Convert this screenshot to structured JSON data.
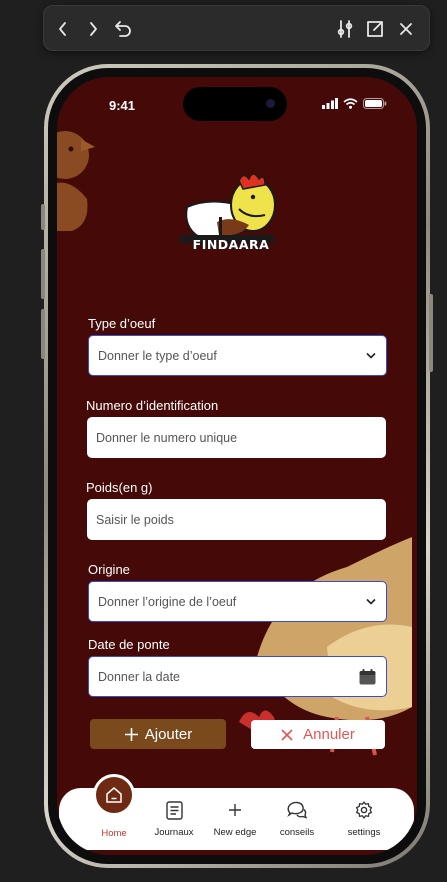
{
  "toolbar": {
    "icons": [
      "back-icon",
      "forward-icon",
      "refresh-icon",
      "sliders-icon",
      "open-external-icon",
      "close-icon"
    ]
  },
  "status": {
    "time": "9:41"
  },
  "logo": {
    "text": "FINDAARA"
  },
  "form": {
    "type_label": "Type d’oeuf",
    "type_placeholder": "Donner le type d’oeuf",
    "id_label": "Numero d’identification",
    "id_placeholder": "Donner le numero unique",
    "weight_label": "Poids(en g)",
    "weight_placeholder": "Saisir le poids",
    "origin_label": "Origine",
    "origin_placeholder": "Donner l’origine de l’oeuf",
    "date_label": "Date de ponte",
    "date_placeholder": "Donner  la date"
  },
  "actions": {
    "add_label": "Ajouter",
    "cancel_label": "Annuler"
  },
  "nav": {
    "home": "Home",
    "journals": "Journaux",
    "new_edge": "New edge",
    "advice": "conseils",
    "settings": "settings"
  },
  "colors": {
    "background": "#450a08",
    "accent": "#7a4a1d",
    "cancel_text": "#e35656",
    "nav_active": "#c0392b"
  }
}
